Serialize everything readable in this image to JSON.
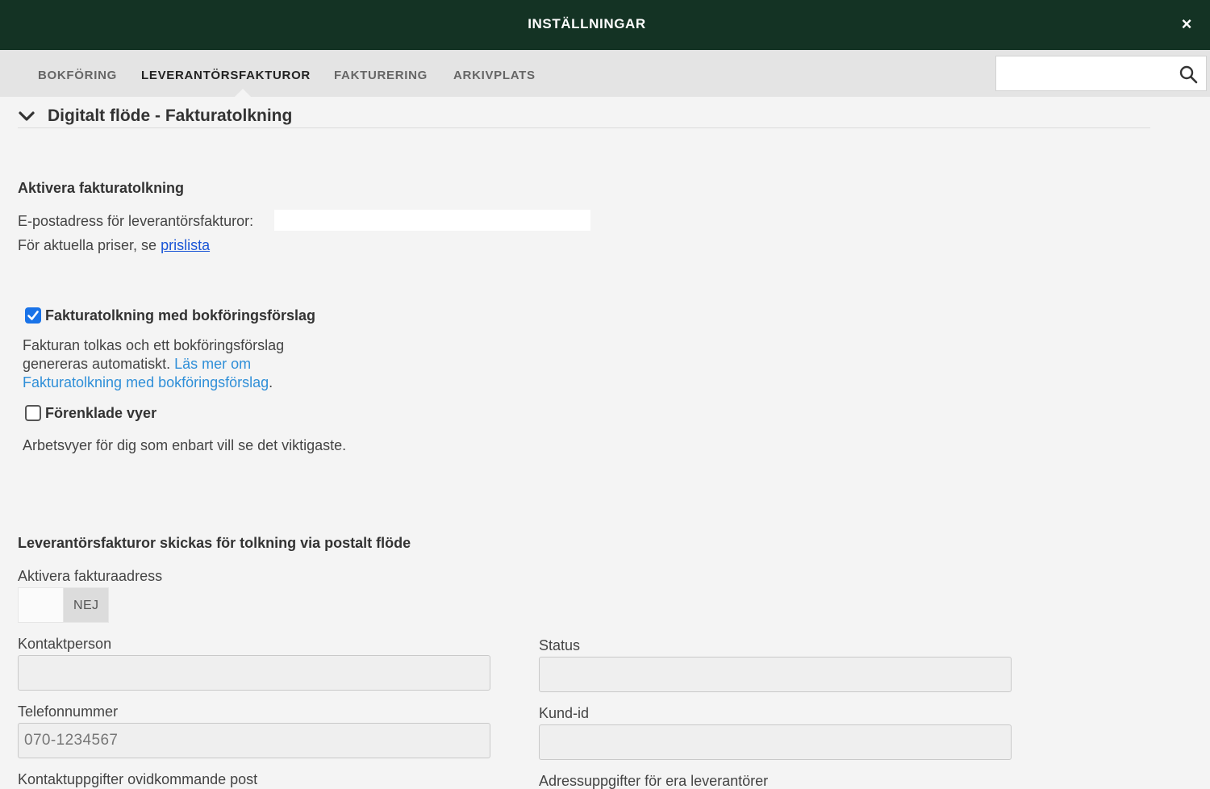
{
  "window": {
    "title": "INSTÄLLNINGAR",
    "close_glyph": "×"
  },
  "tabs": [
    {
      "label": "BOKFÖRING",
      "active": false
    },
    {
      "label": "LEVERANTÖRSFAKTUROR",
      "active": true
    },
    {
      "label": "FAKTURERING",
      "active": false
    },
    {
      "label": "ARKIVPLATS",
      "active": false
    }
  ],
  "search": {
    "value": "",
    "icon": "search-icon"
  },
  "section": {
    "title": "Digitalt flöde - Fakturatolkning",
    "expanded": true,
    "icon": "chevron-down-icon"
  },
  "activate": {
    "heading": "Aktivera fakturatolkning",
    "email_label": "E-postadress för leverantörsfakturor:",
    "prices_prefix": "För aktuella priser, se ",
    "prices_link": "prislista"
  },
  "options": {
    "interpretation": {
      "label": "Fakturatolkning med bokföringsförslag",
      "checked": true,
      "desc_line1": "Fakturan tolkas och ett bokföringsförslag",
      "desc_line2": "genereras automatiskt. ",
      "link_line2": "Läs mer om",
      "link_line3": "Fakturatolkning med bokföringsförslag",
      "suffix": "."
    },
    "simplified": {
      "label": "Förenklade vyer",
      "checked": false,
      "desc": "Arbetsvyer för dig som enbart vill se det viktigaste."
    }
  },
  "postal": {
    "heading": "Leverantörsfakturor skickas för tolkning via postalt flöde",
    "toggle_label": "Aktivera fakturaadress",
    "toggle_value": "NEJ",
    "toggle_on": false,
    "fields": {
      "contact_person": {
        "label": "Kontaktperson",
        "value": ""
      },
      "status": {
        "label": "Status",
        "value": ""
      },
      "phone": {
        "label": "Telefonnummer",
        "value": "070-1234567"
      },
      "customer_id": {
        "label": "Kund-id",
        "value": ""
      },
      "unknown_mail": {
        "label": "Kontaktuppgifter ovidkommande post"
      },
      "supplier_address": {
        "label": "Adressuppgifter för era leverantörer"
      }
    }
  },
  "colors": {
    "titlebar": "#143324",
    "tabbar": "#e4e4e4",
    "background": "#f4f4f4",
    "checkbox_checked": "#1a73e8",
    "link": "#2f8fd8"
  }
}
